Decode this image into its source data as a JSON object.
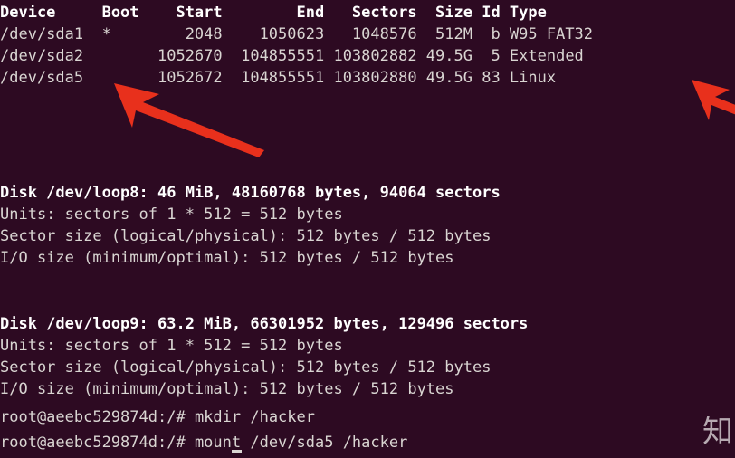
{
  "terminal": {
    "background_color": "#2d0a22",
    "text_color": "#d9d5d2",
    "bold_text_color": "#ffffff",
    "annotation_color": "#e8301c",
    "prompt": "root@aeebc529874d:/#",
    "hostname": "aeebc529874d",
    "user": "root",
    "cwd": "/"
  },
  "partition_table": {
    "header": "Device     Boot    Start        End   Sectors  Size Id Type",
    "columns": [
      "Device",
      "Boot",
      "Start",
      "End",
      "Sectors",
      "Size",
      "Id",
      "Type"
    ],
    "rows": [
      {
        "raw": "/dev/sda1  *        2048    1050623   1048576  512M  b W95 FAT32",
        "device": "/dev/sda1",
        "boot": "*",
        "start": "2048",
        "end": "1050623",
        "sectors": "1048576",
        "size": "512M",
        "id": "b",
        "type": "W95 FAT32"
      },
      {
        "raw": "/dev/sda2        1052670  104855551 103802882 49.5G  5 Extended",
        "device": "/dev/sda2",
        "boot": "",
        "start": "1052670",
        "end": "104855551",
        "sectors": "103802882",
        "size": "49.5G",
        "id": "5",
        "type": "Extended"
      },
      {
        "raw": "/dev/sda5        1052672  104855551 103802880 49.5G 83 Linux",
        "device": "/dev/sda5",
        "boot": "",
        "start": "1052672",
        "end": "104855551",
        "sectors": "103802880",
        "size": "49.5G",
        "id": "83",
        "type": "Linux"
      }
    ]
  },
  "disks": [
    {
      "title": "Disk /dev/loop8: 46 MiB, 48160768 bytes, 94064 sectors",
      "device": "/dev/loop8",
      "size_human": "46 MiB",
      "size_bytes": "48160768",
      "sectors": "94064",
      "units": "Units: sectors of 1 * 512 = 512 bytes",
      "sector_size": "Sector size (logical/physical): 512 bytes / 512 bytes",
      "io_size": "I/O size (minimum/optimal): 512 bytes / 512 bytes"
    },
    {
      "title": "Disk /dev/loop9: 63.2 MiB, 66301952 bytes, 129496 sectors",
      "device": "/dev/loop9",
      "size_human": "63.2 MiB",
      "size_bytes": "66301952",
      "sectors": "129496",
      "units": "Units: sectors of 1 * 512 = 512 bytes",
      "sector_size": "Sector size (logical/physical): 512 bytes / 512 bytes",
      "io_size": "I/O size (minimum/optimal): 512 bytes / 512 bytes"
    }
  ],
  "commands": [
    {
      "prompt": "root@aeebc529874d:/# ",
      "command": "mkdir /hacker"
    },
    {
      "prompt": "root@aeebc529874d:/# ",
      "command": "mount /dev/sda5 /hacker"
    }
  ],
  "annotations": {
    "arrow_color": "#e8301c",
    "arrows": [
      {
        "name": "arrow-pointing-to-dev-sda5",
        "target": "/dev/sda5"
      },
      {
        "name": "arrow-pointing-to-linux-type",
        "target": "Linux"
      }
    ]
  },
  "watermark": {
    "text": "知"
  }
}
